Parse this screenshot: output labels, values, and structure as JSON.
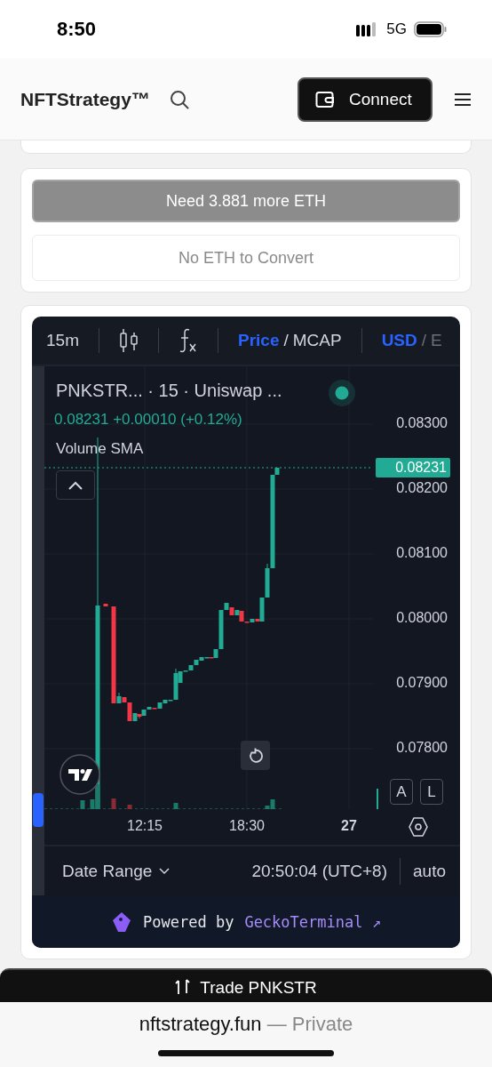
{
  "status_bar": {
    "time": "8:50",
    "network": "5G"
  },
  "header": {
    "logo": "NFTStrategy™",
    "connect_button": "Connect"
  },
  "convert_card": {
    "need_button": {
      "label": "Need 3.881 more ETH",
      "disabled": true
    },
    "convert_button": {
      "label": "No ETH to Convert",
      "disabled": true
    }
  },
  "chart": {
    "toolbar": {
      "interval": "15m",
      "separator": "/",
      "value_toggle": [
        {
          "label": "Price",
          "selected": true
        },
        {
          "label": "MCAP",
          "selected": false
        }
      ],
      "currency_toggle": [
        {
          "label": "USD",
          "selected": true
        },
        {
          "label": "E",
          "selected": false
        }
      ]
    },
    "legend": {
      "title": "PNKSTR... · 15 · Uniswap ...",
      "values": "0.08231 +0.00010 (+0.12%)",
      "indicator": "Volume SMA"
    },
    "price_axis": [
      "0.08300",
      "0.08200",
      "0.08100",
      "0.08000",
      "0.07900",
      "0.07800"
    ],
    "last_price": "0.08231",
    "scale_buttons": [
      "A",
      "L"
    ],
    "time_axis": [
      {
        "label": "12:15",
        "kind": "time"
      },
      {
        "label": "18:30",
        "kind": "time"
      },
      {
        "label": "27",
        "kind": "day"
      }
    ],
    "footer": {
      "date_range": "Date Range",
      "time": "20:50:04 (UTC+8)",
      "scale": "auto"
    },
    "powered": {
      "prefix": "Powered by",
      "link": "GeckoTerminal",
      "arrow": "↗"
    }
  },
  "trade_button": "Trade PNKSTR",
  "browser_bar": {
    "domain": "nftstrategy.fun",
    "mode": "— Private"
  }
}
